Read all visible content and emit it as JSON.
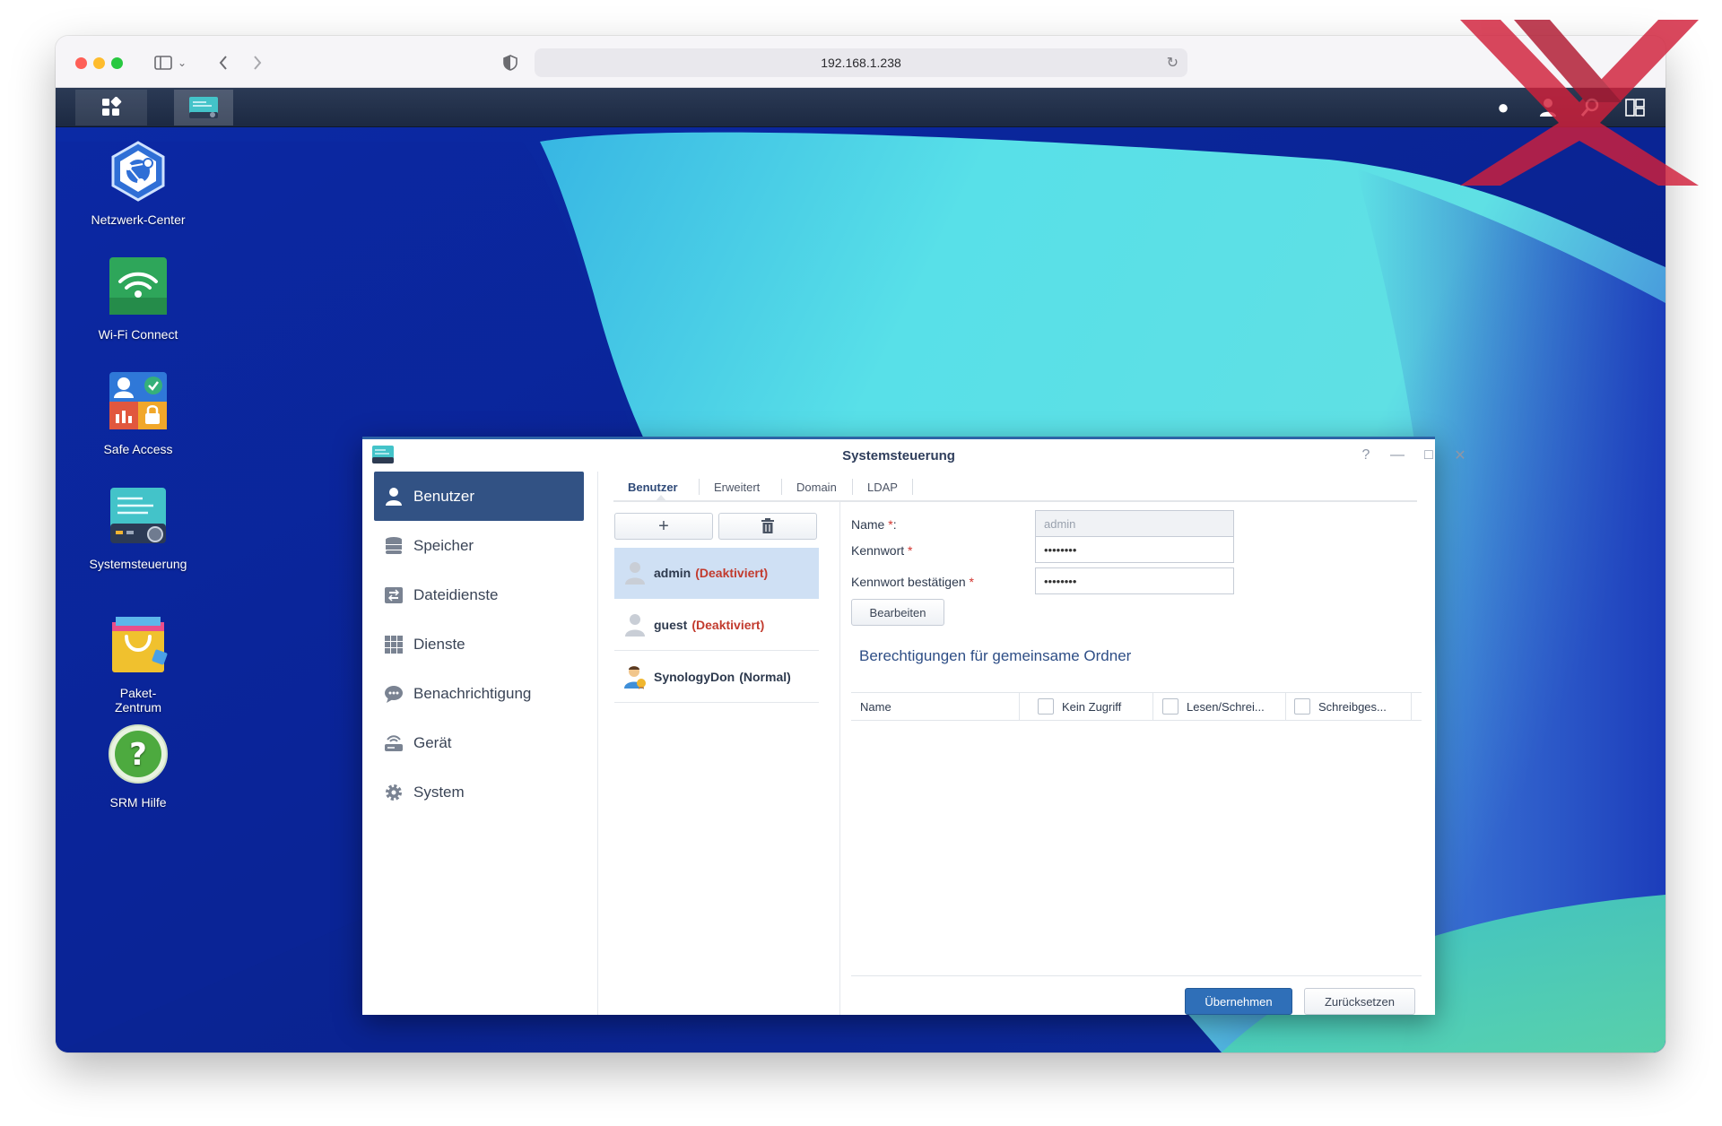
{
  "browser": {
    "url": "192.168.1.238"
  },
  "desktop": {
    "icons": [
      {
        "label": "Netzwerk-Center"
      },
      {
        "label": "Wi-Fi Connect"
      },
      {
        "label": "Safe Access"
      },
      {
        "label": "Systemsteuerung"
      },
      {
        "label": "Paket-\nZentrum"
      },
      {
        "label": "SRM Hilfe"
      }
    ]
  },
  "window": {
    "title": "Systemsteuerung",
    "controls": {
      "help": "?",
      "minimize": "—",
      "maximize": "□",
      "close": "✕"
    },
    "sidebar": [
      {
        "label": "Benutzer",
        "active": true
      },
      {
        "label": "Speicher"
      },
      {
        "label": "Dateidienste"
      },
      {
        "label": "Dienste"
      },
      {
        "label": "Benachrichtigung"
      },
      {
        "label": "Gerät"
      },
      {
        "label": "System"
      }
    ],
    "tabs": [
      {
        "label": "Benutzer",
        "active": true
      },
      {
        "label": "Erweitert"
      },
      {
        "label": "Domain"
      },
      {
        "label": "LDAP"
      }
    ],
    "toolbar": {
      "add": "+",
      "delete": "🗑"
    },
    "users": [
      {
        "name": "admin",
        "state": "(Deaktiviert)",
        "selected": true
      },
      {
        "name": "guest",
        "state": "(Deaktiviert)"
      },
      {
        "name": "SynologyDon",
        "state": "(Normal)"
      }
    ],
    "form": {
      "name_label": "Name",
      "name_req": "*",
      "name_colon": ":",
      "name_value": "admin",
      "password_label": "Kennwort",
      "password_req": "*",
      "password_value": "••••••••",
      "confirm_label": "Kennwort bestätigen",
      "confirm_req": "*",
      "confirm_value": "••••••••",
      "edit_button": "Bearbeiten"
    },
    "permissions": {
      "title": "Berechtigungen für gemeinsame Ordner",
      "columns": [
        "Name",
        "Kein Zugriff",
        "Lesen/Schrei...",
        "Schreibges..."
      ]
    },
    "footer": {
      "apply": "Übernehmen",
      "reset": "Zurücksetzen"
    }
  },
  "colors": {
    "active_sidebar": "#325284",
    "primary_button": "#2f6fb8",
    "deactivated_text": "#c23b2e",
    "selected_row": "#cfe0f4"
  }
}
